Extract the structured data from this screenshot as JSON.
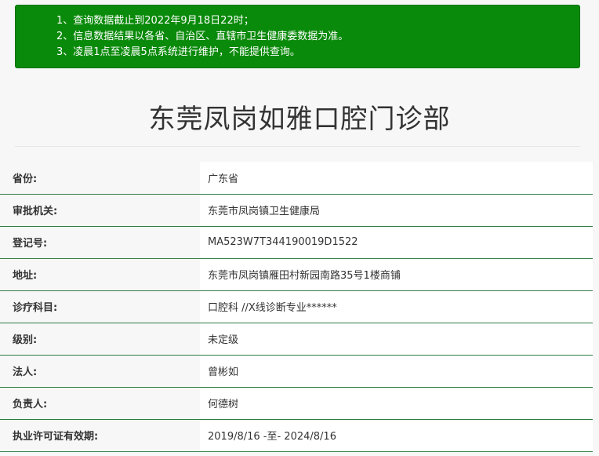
{
  "notice": {
    "lines": [
      "1、查询数据截止到2022年9月18日22时；",
      "2、信息数据结果以各省、自治区、直辖市卫生健康委数据为准。",
      "3、凌晨1点至凌晨5点系统进行维护，不能提供查询。"
    ]
  },
  "page": {
    "title": "东莞凤岗如雅口腔门诊部"
  },
  "info": {
    "rows": [
      {
        "label": "省份:",
        "value": "广东省"
      },
      {
        "label": "审批机关:",
        "value": "东莞市凤岗镇卫生健康局"
      },
      {
        "label": "登记号:",
        "value": "MA523W7T344190019D1522"
      },
      {
        "label": "地址:",
        "value": "东莞市凤岗镇雁田村新园南路35号1楼商铺"
      },
      {
        "label": "诊疗科目:",
        "value": "口腔科 //X线诊断专业******"
      },
      {
        "label": "级别:",
        "value": "未定级"
      },
      {
        "label": "法人:",
        "value": "曾彬如"
      },
      {
        "label": "负责人:",
        "value": "何德树"
      },
      {
        "label": "执业许可证有效期:",
        "value": "2019/8/16 -至- 2024/8/16"
      }
    ]
  },
  "colors": {
    "notice_bg": "#0a8a0a",
    "row_divider": "#2f7d46"
  }
}
